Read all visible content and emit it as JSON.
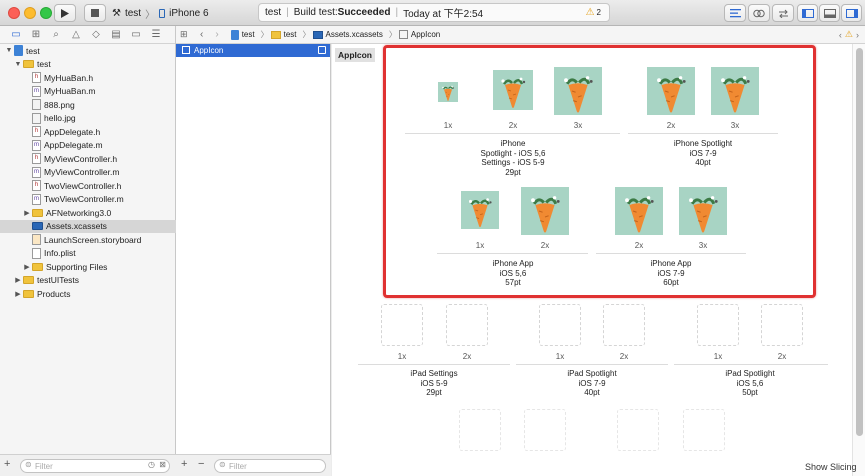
{
  "toolbar": {
    "scheme_target": "test",
    "scheme_device": "iPhone 6",
    "status_project": "test",
    "status_build_prefix": "Build test: ",
    "status_build_result": "Succeeded",
    "status_time": "Today at 下午2:54",
    "warning_count": "2"
  },
  "navigator": {
    "items": [
      {
        "label": "test",
        "kind": "project",
        "indent": 0,
        "disclosure": "open"
      },
      {
        "label": "test",
        "kind": "folder",
        "indent": 1,
        "disclosure": "open"
      },
      {
        "label": "MyHuaBan.h",
        "kind": "h",
        "indent": 2
      },
      {
        "label": "MyHuaBan.m",
        "kind": "m",
        "indent": 2
      },
      {
        "label": "888.png",
        "kind": "img",
        "indent": 2
      },
      {
        "label": "hello.jpg",
        "kind": "img",
        "indent": 2
      },
      {
        "label": "AppDelegate.h",
        "kind": "h",
        "indent": 2
      },
      {
        "label": "AppDelegate.m",
        "kind": "m",
        "indent": 2
      },
      {
        "label": "MyViewController.h",
        "kind": "h",
        "indent": 2
      },
      {
        "label": "MyViewController.m",
        "kind": "m",
        "indent": 2
      },
      {
        "label": "TwoViewController.h",
        "kind": "h",
        "indent": 2
      },
      {
        "label": "TwoViewController.m",
        "kind": "m",
        "indent": 2
      },
      {
        "label": "AFNetworking3.0",
        "kind": "folder",
        "indent": 2,
        "disclosure": "closed"
      },
      {
        "label": "Assets.xcassets",
        "kind": "xcassets",
        "indent": 2,
        "selected": true
      },
      {
        "label": "LaunchScreen.storyboard",
        "kind": "sb",
        "indent": 2
      },
      {
        "label": "Info.plist",
        "kind": "plist",
        "indent": 2
      },
      {
        "label": "Supporting Files",
        "kind": "folder",
        "indent": 2,
        "disclosure": "closed"
      },
      {
        "label": "testUITests",
        "kind": "folder",
        "indent": 1,
        "disclosure": "closed"
      },
      {
        "label": "Products",
        "kind": "folder",
        "indent": 1,
        "disclosure": "closed"
      }
    ],
    "filter_placeholder": "Filter"
  },
  "outline": {
    "selected_item": "AppIcon",
    "filter_placeholder": "Filter",
    "add_symbol": "+",
    "remove_symbol": "−"
  },
  "jumpbar": {
    "crumbs": [
      "test",
      "test",
      "Assets.xcassets",
      "AppIcon"
    ]
  },
  "canvas": {
    "set_name": "AppIcon",
    "iphone_groups": [
      {
        "label": "iPhone\nSpotlight - iOS 5,6\nSettings - iOS 5-9\n29pt",
        "scales": [
          "1x",
          "2x",
          "3x"
        ]
      },
      {
        "label": "iPhone Spotlight\niOS 7-9\n40pt",
        "scales": [
          "2x",
          "3x"
        ]
      },
      {
        "label": "iPhone App\niOS 5,6\n57pt",
        "scales": [
          "1x",
          "2x"
        ]
      },
      {
        "label": "iPhone App\niOS 7-9\n60pt",
        "scales": [
          "2x",
          "3x"
        ]
      }
    ],
    "ipad_groups": [
      {
        "label": "iPad Settings\niOS 5-9\n29pt",
        "scales": [
          "1x",
          "2x"
        ]
      },
      {
        "label": "iPad Spotlight\niOS 7-9\n40pt",
        "scales": [
          "1x",
          "2x"
        ]
      },
      {
        "label": "iPad Spotlight\niOS 5,6\n50pt",
        "scales": [
          "1x",
          "2x"
        ]
      }
    ],
    "show_slicing": "Show Slicing"
  },
  "colors": {
    "highlight": "#e03131",
    "selection": "#2f6ad3",
    "icon_background": "#a8d4c4",
    "carrot": "#f08a32"
  }
}
